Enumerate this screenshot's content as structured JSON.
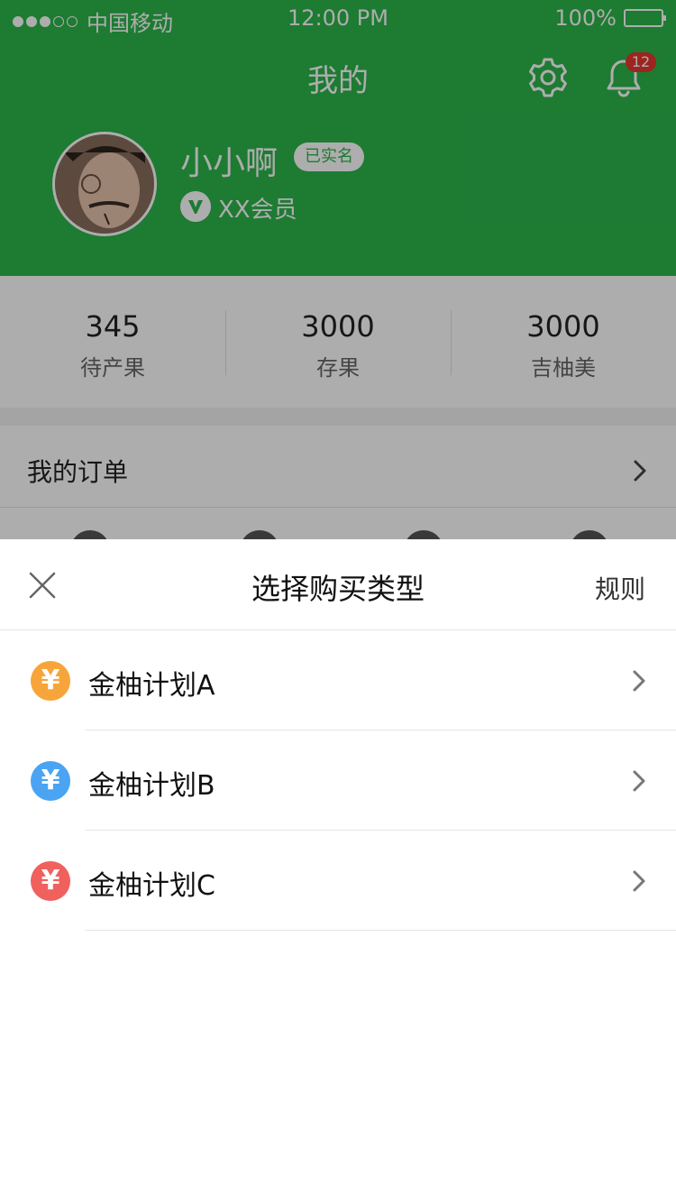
{
  "status_bar": {
    "carrier": "中国移动",
    "time": "12:00 PM",
    "battery": "100%"
  },
  "nav": {
    "title": "我的",
    "notification_count": "12"
  },
  "profile": {
    "name": "小小啊",
    "verified_badge": "已实名",
    "membership": "XX会员"
  },
  "stats": [
    {
      "value": "345",
      "label": "待产果"
    },
    {
      "value": "3000",
      "label": "存果"
    },
    {
      "value": "3000",
      "label": "吉柚美"
    }
  ],
  "orders": {
    "title": "我的订单"
  },
  "sheet": {
    "title": "选择购买类型",
    "rules_label": "规则",
    "plans": [
      {
        "label": "金柚计划A",
        "symbol": "¥",
        "color": "#f7a53a"
      },
      {
        "label": "金柚计划B",
        "symbol": "¥",
        "color": "#4aa4f3"
      },
      {
        "label": "金柚计划C",
        "symbol": "¥",
        "color": "#f0605d"
      }
    ]
  },
  "colors": {
    "brand_green": "#2cb64b",
    "badge_red": "#e8372f"
  }
}
